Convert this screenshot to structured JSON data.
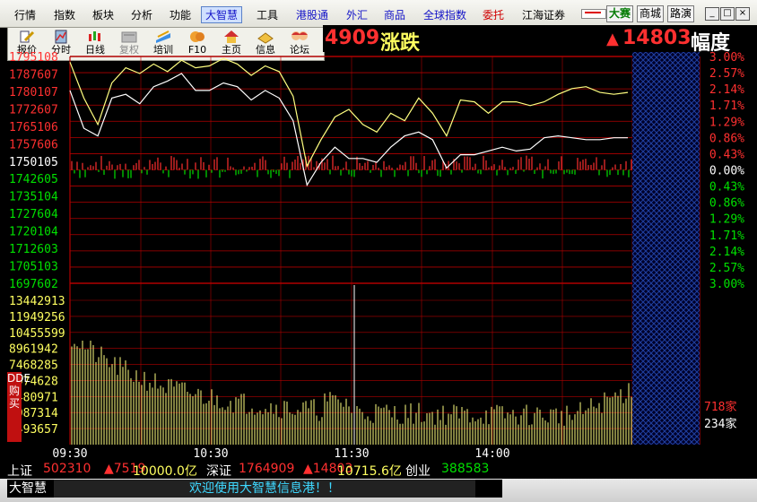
{
  "menu": {
    "items": [
      "行情",
      "指数",
      "板块",
      "分析",
      "功能",
      "大智慧",
      "工具",
      "港股通",
      "外汇",
      "商品",
      "全球指数",
      "委托",
      "江海证券"
    ],
    "active_index": 5,
    "right_buttons": [
      "大赛",
      "商城",
      "路演"
    ],
    "window_controls": [
      "_",
      "□",
      "×"
    ]
  },
  "toolbar": {
    "items": [
      {
        "label": "报价",
        "icon": "quote-icon"
      },
      {
        "label": "分时",
        "icon": "timeshare-icon"
      },
      {
        "label": "日线",
        "icon": "candlestick-icon"
      },
      {
        "label": "复权",
        "icon": "adjust-icon",
        "disabled": true
      },
      {
        "label": "培训",
        "icon": "training-icon"
      },
      {
        "label": "F10",
        "icon": "f10-icon"
      },
      {
        "label": "主页",
        "icon": "home-icon"
      },
      {
        "label": "信息",
        "icon": "info-icon"
      },
      {
        "label": "论坛",
        "icon": "forum-icon"
      }
    ]
  },
  "header": {
    "left_value": "4909",
    "left_label": "涨跌",
    "right_value": "14803",
    "right_label": "幅度"
  },
  "chart_data": {
    "type": "line",
    "prices": [
      "1795108",
      "1787607",
      "1780107",
      "1772607",
      "1765106",
      "1757606",
      "1750105",
      "1742605",
      "1735104",
      "1727604",
      "1720104",
      "1712603",
      "1705103",
      "1697602"
    ],
    "percents": [
      "3.00%",
      "2.57%",
      "2.14%",
      "1.71%",
      "1.29%",
      "0.86%",
      "0.43%",
      "0.00%",
      "0.43%",
      "0.86%",
      "1.29%",
      "1.71%",
      "2.14%",
      "2.57%",
      "3.00%"
    ],
    "volume_ticks": [
      "13442913",
      "11949256",
      "10455599",
      "8961942",
      "7468285",
      "5974628",
      "4480971",
      "2987314",
      "1493657"
    ],
    "time_ticks": [
      "09:30",
      "10:30",
      "11:30",
      "14:00"
    ],
    "adv_count": "718家",
    "dec_count": "234家",
    "dde_label": "DDE购买",
    "series": [
      {
        "x": [
          0,
          0.025,
          0.05,
          0.075,
          0.1,
          0.125,
          0.15,
          0.175,
          0.2,
          0.225,
          0.25,
          0.275,
          0.3,
          0.325,
          0.35,
          0.375,
          0.4,
          0.425,
          0.45,
          0.475,
          0.5,
          0.525,
          0.55,
          0.575,
          0.6,
          0.625,
          0.65,
          0.675,
          0.7,
          0.725,
          0.75,
          0.775,
          0.8,
          0.825,
          0.85,
          0.875,
          0.9,
          0.925,
          0.95,
          0.975,
          1.0
        ],
        "y": [
          2.85,
          1.9,
          1.2,
          2.3,
          2.7,
          2.55,
          2.8,
          2.6,
          2.9,
          2.7,
          2.75,
          2.95,
          2.8,
          2.5,
          2.75,
          2.6,
          1.95,
          0.1,
          0.8,
          1.4,
          1.6,
          1.2,
          1.0,
          1.5,
          1.3,
          1.9,
          1.5,
          0.9,
          1.85,
          1.8,
          1.5,
          1.8,
          1.8,
          1.7,
          1.8,
          2.0,
          2.15,
          2.2,
          2.05,
          2.0,
          2.05
        ]
      },
      {
        "x": [
          0,
          0.025,
          0.05,
          0.075,
          0.1,
          0.125,
          0.15,
          0.175,
          0.2,
          0.225,
          0.25,
          0.275,
          0.3,
          0.325,
          0.35,
          0.375,
          0.4,
          0.425,
          0.45,
          0.475,
          0.5,
          0.525,
          0.55,
          0.575,
          0.6,
          0.625,
          0.65,
          0.675,
          0.7,
          0.725,
          0.75,
          0.775,
          0.8,
          0.825,
          0.85,
          0.875,
          0.9,
          0.925,
          0.95,
          0.975,
          1.0
        ],
        "y": [
          2.1,
          1.1,
          0.9,
          1.9,
          2.0,
          1.75,
          2.2,
          2.35,
          2.55,
          2.1,
          2.1,
          2.3,
          2.2,
          1.85,
          2.1,
          1.9,
          1.3,
          -0.4,
          0.2,
          0.6,
          0.3,
          0.3,
          0.2,
          0.6,
          0.9,
          1.0,
          0.8,
          0.05,
          0.4,
          0.4,
          0.5,
          0.6,
          0.5,
          0.55,
          0.85,
          0.9,
          0.85,
          0.8,
          0.8,
          0.85,
          0.85
        ]
      }
    ],
    "ylim": [
      -3,
      3
    ]
  },
  "statusbar": {
    "sh_label": "上证",
    "sh_value": "502310",
    "sh_change": "▲7519",
    "sh_amount": "10000.0亿",
    "sz_label": "深证",
    "sz_value": "1764909",
    "sz_change": "▲14803",
    "sz_amount": "10715.6亿",
    "cy_label": "创业",
    "cy_value": "388583"
  },
  "bottombar": {
    "brand": "大智慧",
    "welcome": "欢迎使用大智慧信息港！！"
  },
  "colors": {
    "up": "#ff3030",
    "down": "#00e000",
    "flat": "#ffffff",
    "grid": "#b00000",
    "ma": "#ffff80"
  }
}
